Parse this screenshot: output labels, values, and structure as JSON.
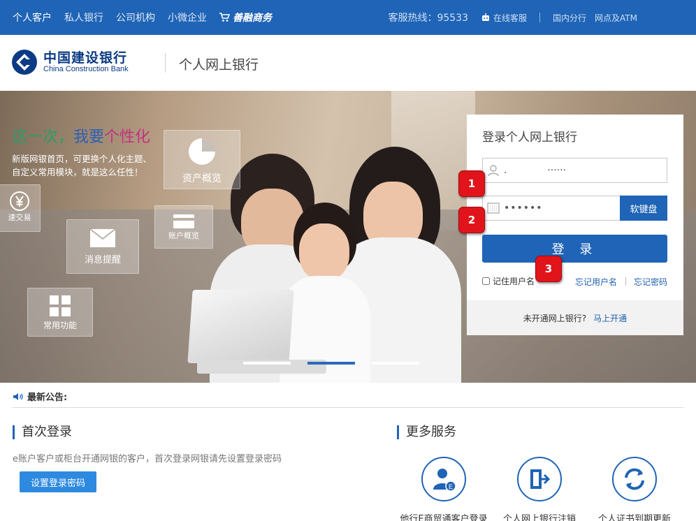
{
  "topnav": {
    "items": [
      "个人客户",
      "私人银行",
      "公司机构",
      "小微企业"
    ],
    "shop_label": "善融商务",
    "hotline": "客服热线：95533",
    "online_service": "在线客服",
    "links": [
      "国内分行",
      "网点及ATM"
    ]
  },
  "header": {
    "bank_name_cn": "中国建设银行",
    "bank_name_en": "China Construction Bank",
    "page_title": "个人网上银行"
  },
  "banner": {
    "slogan_part1": "这一次，",
    "slogan_part2": "我要",
    "slogan_part3": "个性化",
    "subtitle": "新版网银首页，可更换个人化主题、自定义常用模块，就是这么任性！",
    "tiles": {
      "asset": "资产概览",
      "quick_trade": "速交易",
      "account": "账户概览",
      "message": "消息提醒",
      "common": "常用功能"
    }
  },
  "login": {
    "title": "登录个人网上银行",
    "username_value": ".             ······  ",
    "password_value": "••••••",
    "soft_keyboard": "软键盘",
    "login_button": "登 录",
    "remember_label": "记住用户名",
    "forgot_username": "忘记用户名",
    "forgot_password": "忘记密码",
    "not_open_text": "未开通网上银行?",
    "open_now": "马上开通"
  },
  "markers": [
    "1",
    "2",
    "3"
  ],
  "notice": {
    "label": "最新公告:"
  },
  "first_login": {
    "title": "首次登录",
    "desc": "e账户客户或柜台开通网银的客户，首次登录网银请先设置登录密码",
    "button": "设置登录密码"
  },
  "more_services": {
    "title": "更多服务",
    "items": [
      "他行E商贸通客户登录",
      "个人网上银行注销",
      "个人证书到期更新"
    ]
  },
  "colors": {
    "brand": "#1f64b6",
    "marker": "#e0141a"
  }
}
